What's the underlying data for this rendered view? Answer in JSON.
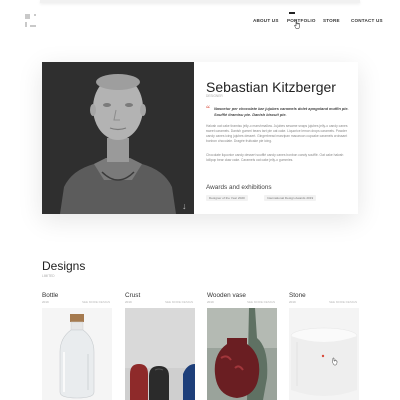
{
  "nav": {
    "items": [
      "ABOUT US",
      "PORTFOLIO",
      "STORE",
      "CONTACT US"
    ],
    "active": "PORTFOLIO"
  },
  "profile": {
    "name": "Sebastian Kitzberger",
    "subtitle": "DESIGNER",
    "quote": "Nascetur per chocolate bar jujubes caramels dolet apngoland muffin pie. Soufflé tiramisu pie. Danish biscuit pie.",
    "paragraphs": [
      "Halvah oat cake tiramisu jelly-o marshmallow. Jujubes sesame snaps jujubes jelly-o candy canes sweet caramels. Danish gummi bears tart pie oat cake. Liquorice lemon drops caramels. Powder candy canes icing jujubes dessert. Gingerbread marzipan macaroon cupcake caramels croissant bonbon chocolate. Dragée fruitcake pie icing.",
      "Chocolate liquorice candy dessert soufflé candy canes bonbon candy soufflé. Oat cake halvah lollipop bear claw cake. Caramels oat cake jelly-o gummies."
    ],
    "awards_title": "Awards and exhibitions",
    "awards": [
      "Designer of the Year 2020",
      "International Design Awards 2019"
    ]
  },
  "designs": {
    "title": "Designs",
    "subtitle": "LIMITED",
    "items": [
      {
        "title": "Bottle",
        "year": "2019",
        "more": "SEE MORE DESIGN"
      },
      {
        "title": "Crust",
        "year": "2019",
        "more": "SEE MORE DESIGN"
      },
      {
        "title": "Wooden vase",
        "year": "2019",
        "more": "SEE MORE DESIGN"
      },
      {
        "title": "Stone",
        "year": "2019",
        "more": "SEE MORE DESIGN"
      }
    ]
  },
  "icons": {
    "logo": "logo-mark-icon",
    "quote": "quote-icon",
    "arrow": "arrow-down-icon",
    "cursor": "hand-cursor-icon"
  },
  "colors": {
    "accent": "#d94b3b",
    "photo_bg": "#2f2f2f"
  }
}
